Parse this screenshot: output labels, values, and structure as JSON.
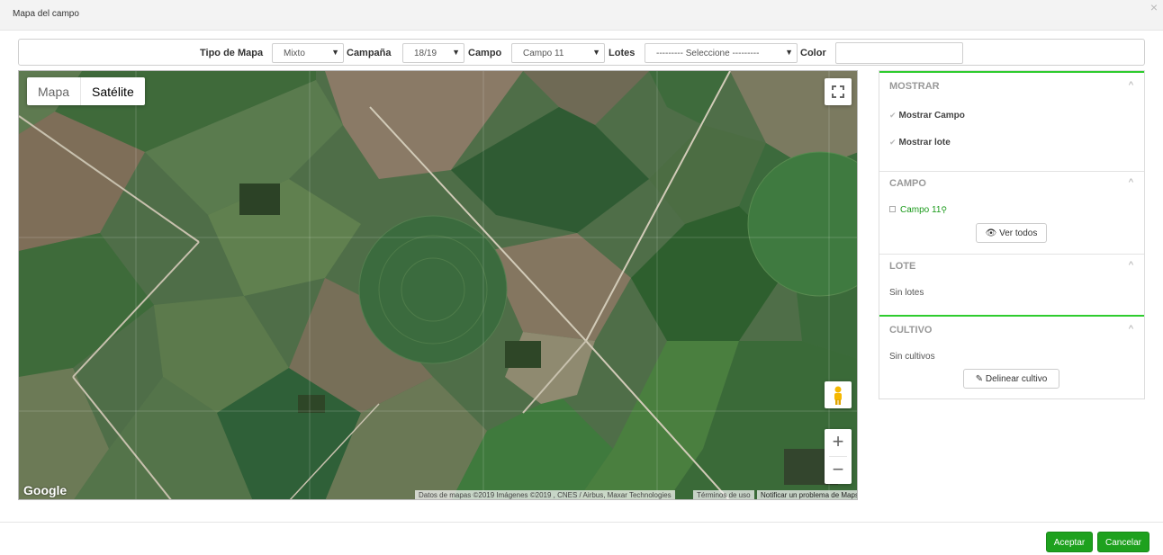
{
  "modal": {
    "title": "Mapa del campo",
    "close_icon": "×"
  },
  "filters": {
    "tipo_mapa_label": "Tipo de Mapa",
    "tipo_mapa_value": "Mixto",
    "campana_label": "Campaña",
    "campana_value": "18/19",
    "campo_label": "Campo",
    "campo_value": "Campo 11",
    "lotes_label": "Lotes",
    "lotes_value": "--------- Seleccione ---------",
    "color_label": "Color",
    "color_value": ""
  },
  "map": {
    "type_map_label": "Mapa",
    "type_satellite_label": "Satélite",
    "selected_type": "Satélite",
    "google_logo": "Google",
    "attribution": "Datos de mapas ©2019 Imágenes ©2019 , CNES / Airbus, Maxar Technologies",
    "terms": "Términos de uso",
    "report": "Notificar un problema de Maps",
    "zoom_in": "+",
    "zoom_out": "−",
    "icons": [
      "fullscreen-icon",
      "pegman-icon",
      "zoom-in-icon",
      "zoom-out-icon"
    ]
  },
  "panel": {
    "mostrar": {
      "title": "MOSTRAR",
      "items": [
        {
          "label": "Mostrar Campo",
          "checked": true
        },
        {
          "label": "Mostrar lote",
          "checked": true
        }
      ]
    },
    "campo": {
      "title": "CAMPO",
      "item_label": "Campo 11",
      "ver_todos": "Ver todos"
    },
    "lote": {
      "title": "LOTE",
      "empty_text": "Sin lotes"
    },
    "cultivo": {
      "title": "CULTIVO",
      "empty_text": "Sin cultivos",
      "delinear": "Delinear cultivo"
    },
    "chevron": "^"
  },
  "footer": {
    "accept": "Aceptar",
    "cancel": "Cancelar"
  },
  "colors": {
    "accent_green": "#1ea11e",
    "panel_active_border": "#2ecc2e",
    "link_green": "#1a9a1a"
  }
}
